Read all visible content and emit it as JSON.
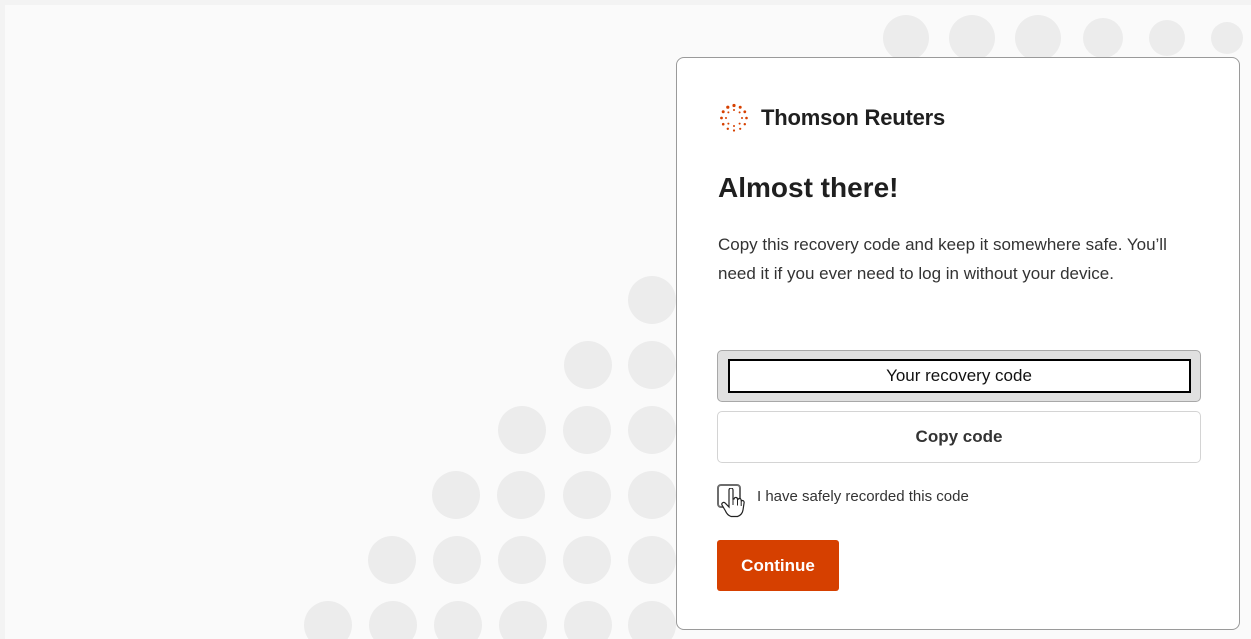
{
  "brand": {
    "name": "Thomson Reuters",
    "logo_icon": "thomson-reuters-logo-icon",
    "accent_color": "#d64000"
  },
  "heading": "Almost there!",
  "description": "Copy this recovery code and keep it somewhere safe. You’ll need it if you ever need to log in without your device.",
  "recovery_code": {
    "label": "Your recovery code"
  },
  "copy_button": {
    "label": "Copy code"
  },
  "confirmation": {
    "label": "I have safely recorded this code",
    "checked": false
  },
  "continue_button": {
    "label": "Continue"
  }
}
